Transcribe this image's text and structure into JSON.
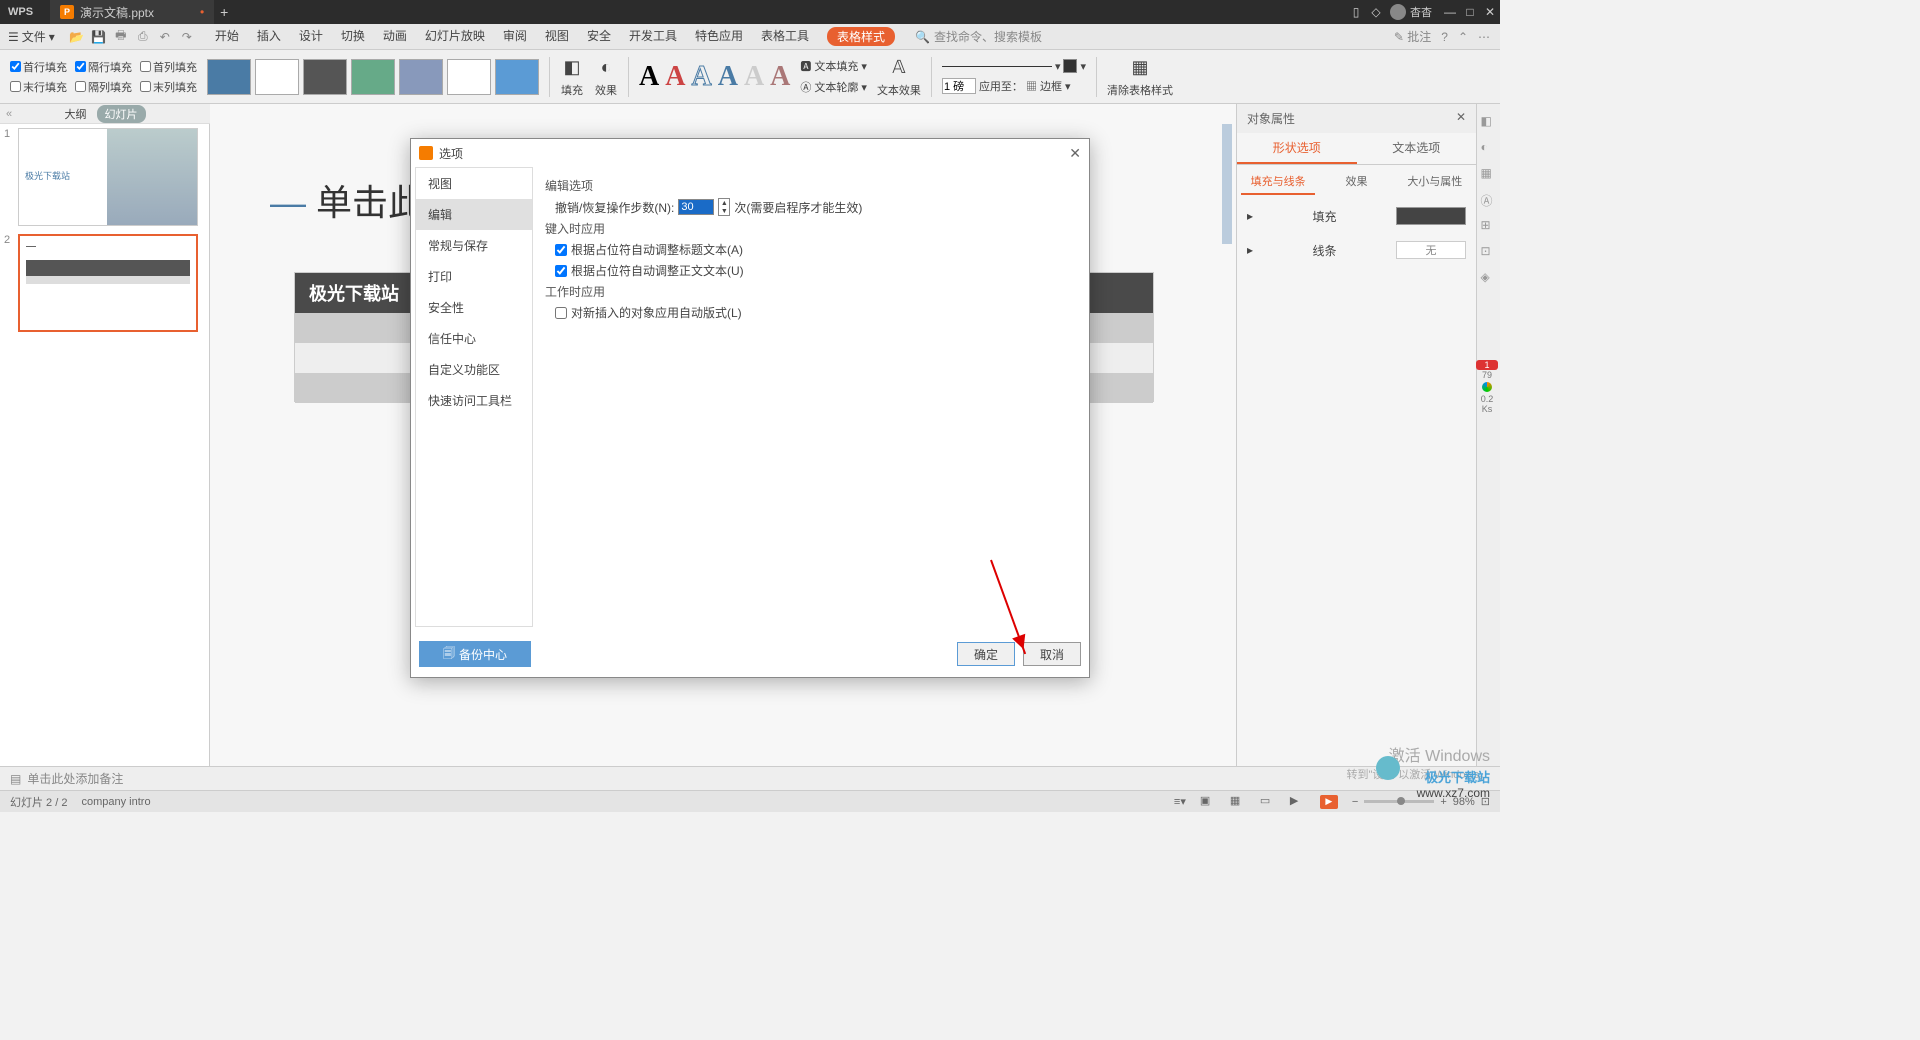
{
  "titlebar": {
    "app": "WPS",
    "doc": "演示文稿.pptx",
    "user": "杳杳"
  },
  "menubar": {
    "file": "文件",
    "tabs": [
      "开始",
      "插入",
      "设计",
      "切换",
      "动画",
      "幻灯片放映",
      "审阅",
      "视图",
      "安全",
      "开发工具",
      "特色应用",
      "表格工具",
      "表格样式"
    ],
    "search": "查找命令、搜索模板",
    "annotate": "批注"
  },
  "ribbon": {
    "fill_options": [
      {
        "label": "首行填充",
        "checked": true
      },
      {
        "label": "隔行填充",
        "checked": true
      },
      {
        "label": "首列填充",
        "checked": false
      },
      {
        "label": "末行填充",
        "checked": false
      },
      {
        "label": "隔列填充",
        "checked": false
      },
      {
        "label": "末列填充",
        "checked": false
      }
    ],
    "fill_btn": "填充",
    "effect_btn": "效果",
    "text_fill": "文本填充",
    "text_outline": "文本轮廓",
    "text_effect": "文本效果",
    "line_weight_value": "1 磅",
    "apply_to": "应用至：",
    "border": "边框",
    "clear_style": "清除表格样式"
  },
  "outline": {
    "outline_tab": "大纲",
    "slides_tab": "幻灯片"
  },
  "thumbs": {
    "slide1_text": "极光下载站",
    "slide2_text": ""
  },
  "slide": {
    "title_prefix": "—",
    "title": "单击此",
    "table_header": "极光下载站"
  },
  "prop_pane": {
    "title": "对象属性",
    "tab_shape": "形状选项",
    "tab_text": "文本选项",
    "subtab_fill": "填充与线条",
    "subtab_effect": "效果",
    "subtab_size": "大小与属性",
    "fill_label": "填充",
    "line_label": "线条",
    "line_value": "无"
  },
  "notes": {
    "placeholder": "单击此处添加备注"
  },
  "statusbar": {
    "slide_pos": "幻灯片 2 / 2",
    "lang": "company intro",
    "zoom": "98%"
  },
  "dialog": {
    "title": "选项",
    "nav": [
      "视图",
      "编辑",
      "常规与保存",
      "打印",
      "安全性",
      "信任中心",
      "自定义功能区",
      "快速访问工具栏"
    ],
    "nav_active": "编辑",
    "section_edit": "编辑选项",
    "undo_label": "撤销/恢复操作步数(N):",
    "undo_value": "30",
    "undo_hint": "次(需要启程序才能生效)",
    "section_typing": "键入时应用",
    "chk_title": "根据占位符自动调整标题文本(A)",
    "chk_body": "根据占位符自动调整正文文本(U)",
    "section_work": "工作时应用",
    "chk_auto_layout": "对新插入的对象应用自动版式(L)",
    "backup": "备份中心",
    "ok": "确定",
    "cancel": "取消"
  },
  "watermark": {
    "line1": "激活 Windows",
    "line2": "转到\"设置\"以激活 Windows。",
    "site": "极光下载站",
    "url": "www.xz7.com"
  },
  "badge": {
    "num1": "1",
    "num79": "79"
  }
}
